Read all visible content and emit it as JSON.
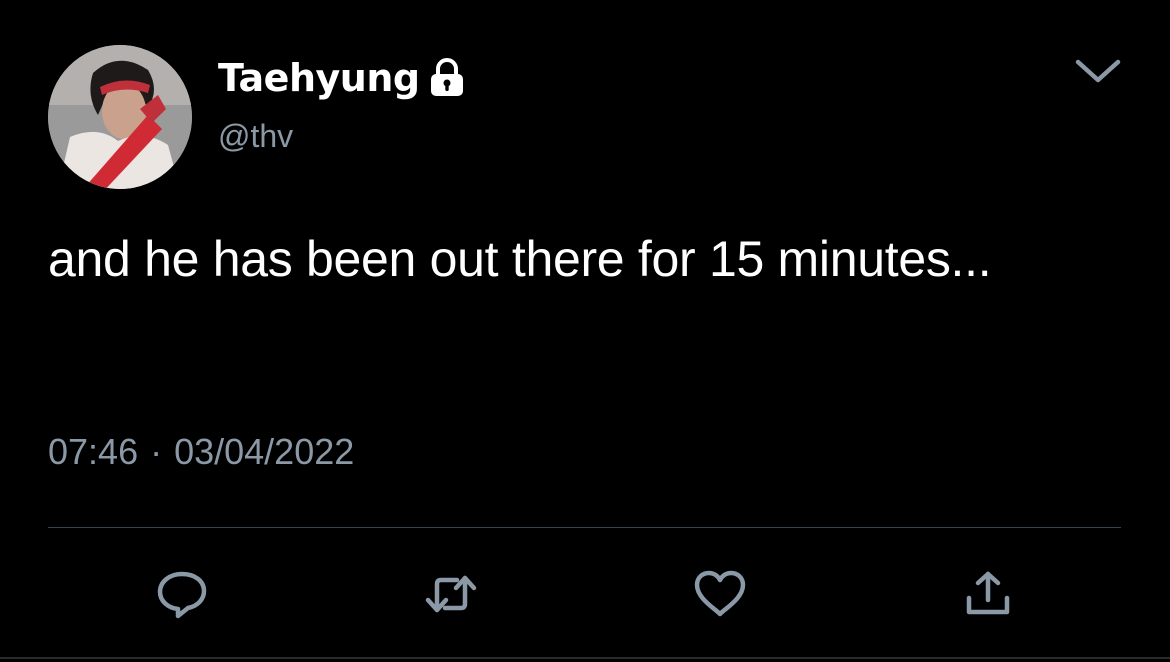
{
  "tweet": {
    "display_name": "Taehyung",
    "handle": "@thv",
    "text": "and he has been out there for 15 minutes...",
    "time": "07:46",
    "separator": "·",
    "date": "03/04/2022"
  },
  "icons": {
    "lock": "lock-icon",
    "menu": "chevron-down-icon",
    "reply": "reply-icon",
    "retweet": "retweet-icon",
    "like": "heart-icon",
    "share": "share-icon"
  },
  "colors": {
    "background": "#000000",
    "text_primary": "#ffffff",
    "text_secondary": "#8b98a5",
    "divider": "#38444d"
  }
}
